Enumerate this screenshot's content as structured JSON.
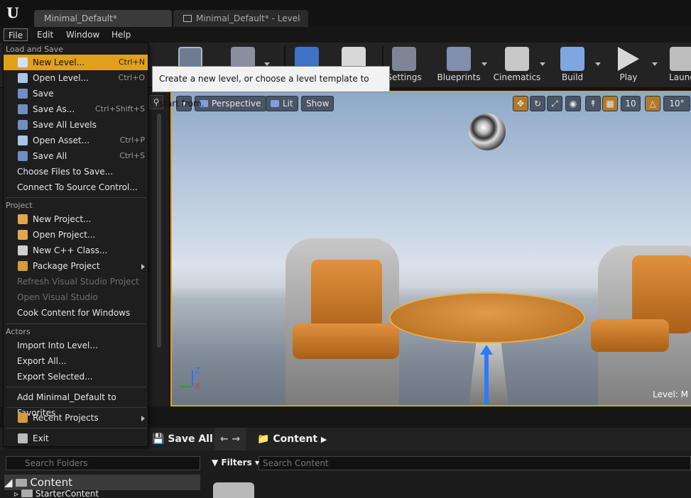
{
  "tabs": [
    {
      "label": "Minimal_Default*"
    },
    {
      "label": "Minimal_Default* - Level B"
    }
  ],
  "logo": "U",
  "menu": {
    "file": "File",
    "edit": "Edit",
    "window": "Window",
    "help": "Help"
  },
  "toolbar": {
    "settings": "Settings",
    "blueprints": "Blueprints",
    "cinematics": "Cinematics",
    "build": "Build",
    "play": "Play",
    "launch": "Launc"
  },
  "tooltip": "Create a new level, or choose a level template to start from.",
  "viewport": {
    "perspective": "Perspective",
    "lit": "Lit",
    "show": "Show",
    "grid_snap": "10",
    "rotation_snap": "10°",
    "level_label": "Level:  M"
  },
  "file_menu": {
    "sections": {
      "load_save": "Load and Save",
      "project": "Project",
      "actors": "Actors"
    },
    "items": {
      "new_level": {
        "label": "New Level...",
        "shortcut": "Ctrl+N"
      },
      "open_level": {
        "label": "Open Level...",
        "shortcut": "Ctrl+O"
      },
      "save": {
        "label": "Save",
        "shortcut": ""
      },
      "save_as": {
        "label": "Save As...",
        "shortcut": "Ctrl+Shift+S"
      },
      "save_all_levels": {
        "label": "Save All Levels",
        "shortcut": ""
      },
      "open_asset": {
        "label": "Open Asset...",
        "shortcut": "Ctrl+P"
      },
      "save_all": {
        "label": "Save All",
        "shortcut": "Ctrl+S"
      },
      "choose_files": {
        "label": "Choose Files to Save...",
        "shortcut": ""
      },
      "connect_source": {
        "label": "Connect To Source Control...",
        "shortcut": ""
      },
      "new_project": {
        "label": "New Project...",
        "shortcut": ""
      },
      "open_project": {
        "label": "Open Project...",
        "shortcut": ""
      },
      "new_cpp_class": {
        "label": "New C++ Class...",
        "shortcut": ""
      },
      "package_project": {
        "label": "Package Project",
        "shortcut": ""
      },
      "refresh_vs": {
        "label": "Refresh Visual Studio Project",
        "shortcut": ""
      },
      "open_vs": {
        "label": "Open Visual Studio",
        "shortcut": ""
      },
      "cook_content": {
        "label": "Cook Content for Windows",
        "shortcut": ""
      },
      "import_into_level": {
        "label": "Import Into Level...",
        "shortcut": ""
      },
      "export_all": {
        "label": "Export All...",
        "shortcut": ""
      },
      "export_selected": {
        "label": "Export Selected...",
        "shortcut": ""
      },
      "add_favorites": {
        "label": "Add Minimal_Default to Favorites",
        "shortcut": ""
      },
      "recent_projects": {
        "label": "Recent Projects",
        "shortcut": ""
      },
      "exit": {
        "label": "Exit",
        "shortcut": ""
      }
    }
  },
  "content_browser": {
    "save_all": "Save All",
    "path": "Content",
    "filters": "Filters",
    "search_folders_placeholder": "Search Folders",
    "search_content_placeholder": "Search Content",
    "tree": {
      "root": "Content",
      "child": "StarterContent"
    }
  },
  "colors": {
    "accent": "#e1a11a"
  }
}
